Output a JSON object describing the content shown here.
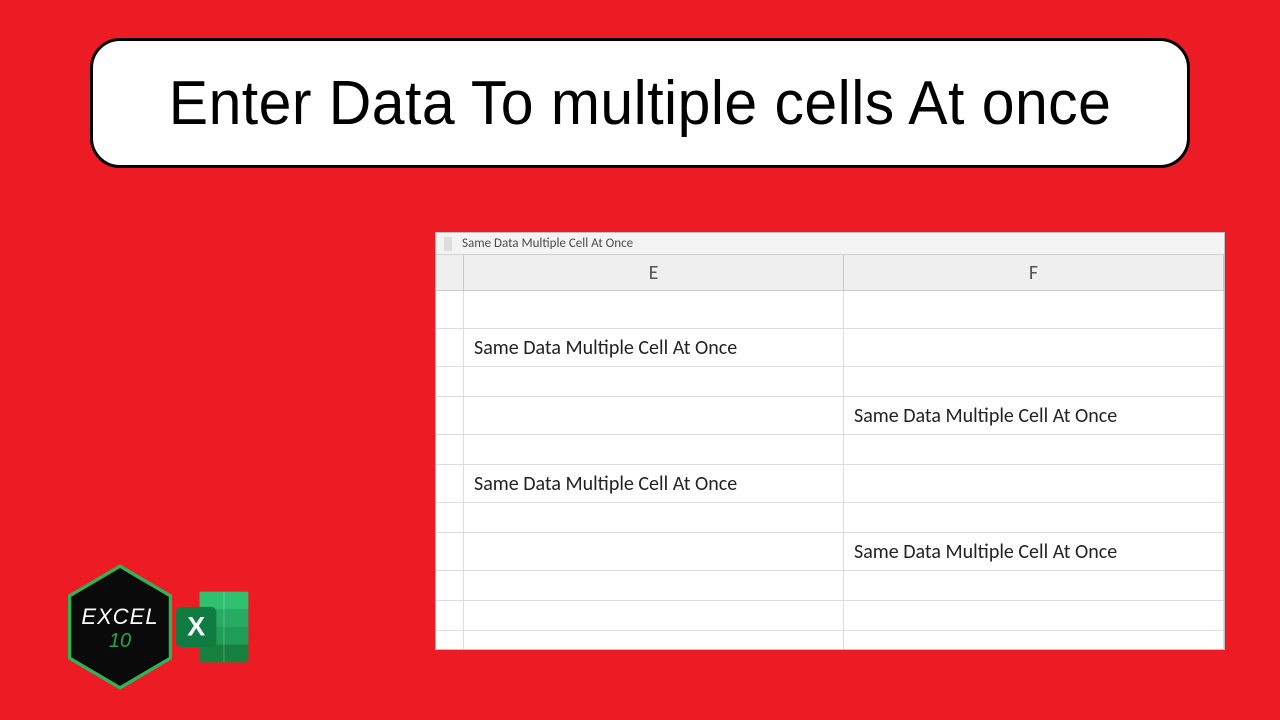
{
  "title": "Enter Data To multiple cells At once",
  "formula_bar_text": "Same Data Multiple Cell At Once",
  "columns": [
    "E",
    "F"
  ],
  "rows": [
    {
      "E": "",
      "F": ""
    },
    {
      "E": "Same Data Multiple Cell At Once",
      "F": ""
    },
    {
      "E": "",
      "F": ""
    },
    {
      "E": "",
      "F": "Same Data Multiple Cell At Once"
    },
    {
      "E": "",
      "F": ""
    },
    {
      "E": "Same Data Multiple Cell At Once",
      "F": ""
    },
    {
      "E": "",
      "F": ""
    },
    {
      "E": "",
      "F": "Same Data Multiple Cell At Once"
    },
    {
      "E": "",
      "F": ""
    },
    {
      "E": "",
      "F": ""
    },
    {
      "E": "",
      "F": ""
    }
  ],
  "logo": {
    "top": "EXCEL",
    "bottom": "10",
    "x_letter": "X"
  }
}
